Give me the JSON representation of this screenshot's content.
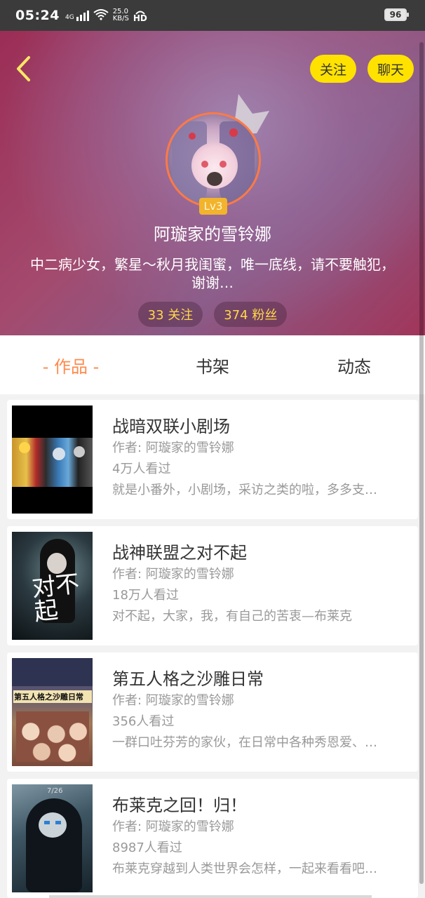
{
  "status_bar": {
    "time": "05:24",
    "signal": "4G",
    "speed_top": "25.0",
    "speed_bottom": "KB/S",
    "hd": "HD",
    "battery": "96"
  },
  "header": {
    "follow_label": "关注",
    "chat_label": "聊天",
    "level": "Lv3",
    "username": "阿璇家的雪铃娜",
    "bio": "中二病少女，繁星〜秋月我闺蜜，唯一底线，请不要触犯，谢谢…",
    "following": "33 关注",
    "followers": "374 粉丝",
    "accent_color": "#ffe200"
  },
  "tabs": [
    {
      "label": "- 作品 -"
    },
    {
      "label": "书架"
    },
    {
      "label": "动态"
    }
  ],
  "works": [
    {
      "title": "战暗双联小剧场",
      "author": "作者: 阿璇家的雪铃娜",
      "views": "4万人看过",
      "desc": "就是小番外，小剧场，采访之类的啦，多多支…"
    },
    {
      "title": "战神联盟之对不起",
      "author": "作者: 阿璇家的雪铃娜",
      "views": "18万人看过",
      "desc": "对不起，大家，我，有自己的苦衷—布莱克"
    },
    {
      "title": "第五人格之沙雕日常",
      "author": "作者: 阿璇家的雪铃娜",
      "views": "356人看过",
      "desc": "一群口吐芬芳的家伙，在日常中各种秀恩爱、…"
    },
    {
      "title": "布莱克之回！归！",
      "author": "作者: 阿璇家的雪铃娜",
      "views": "8987人看过",
      "desc": "布莱克穿越到人类世界会怎样，一起来看看吧…"
    }
  ],
  "covers": {
    "c2_text": "对不起",
    "c3_text": "第五人格之沙雕日常",
    "c4_text": "7/26"
  }
}
